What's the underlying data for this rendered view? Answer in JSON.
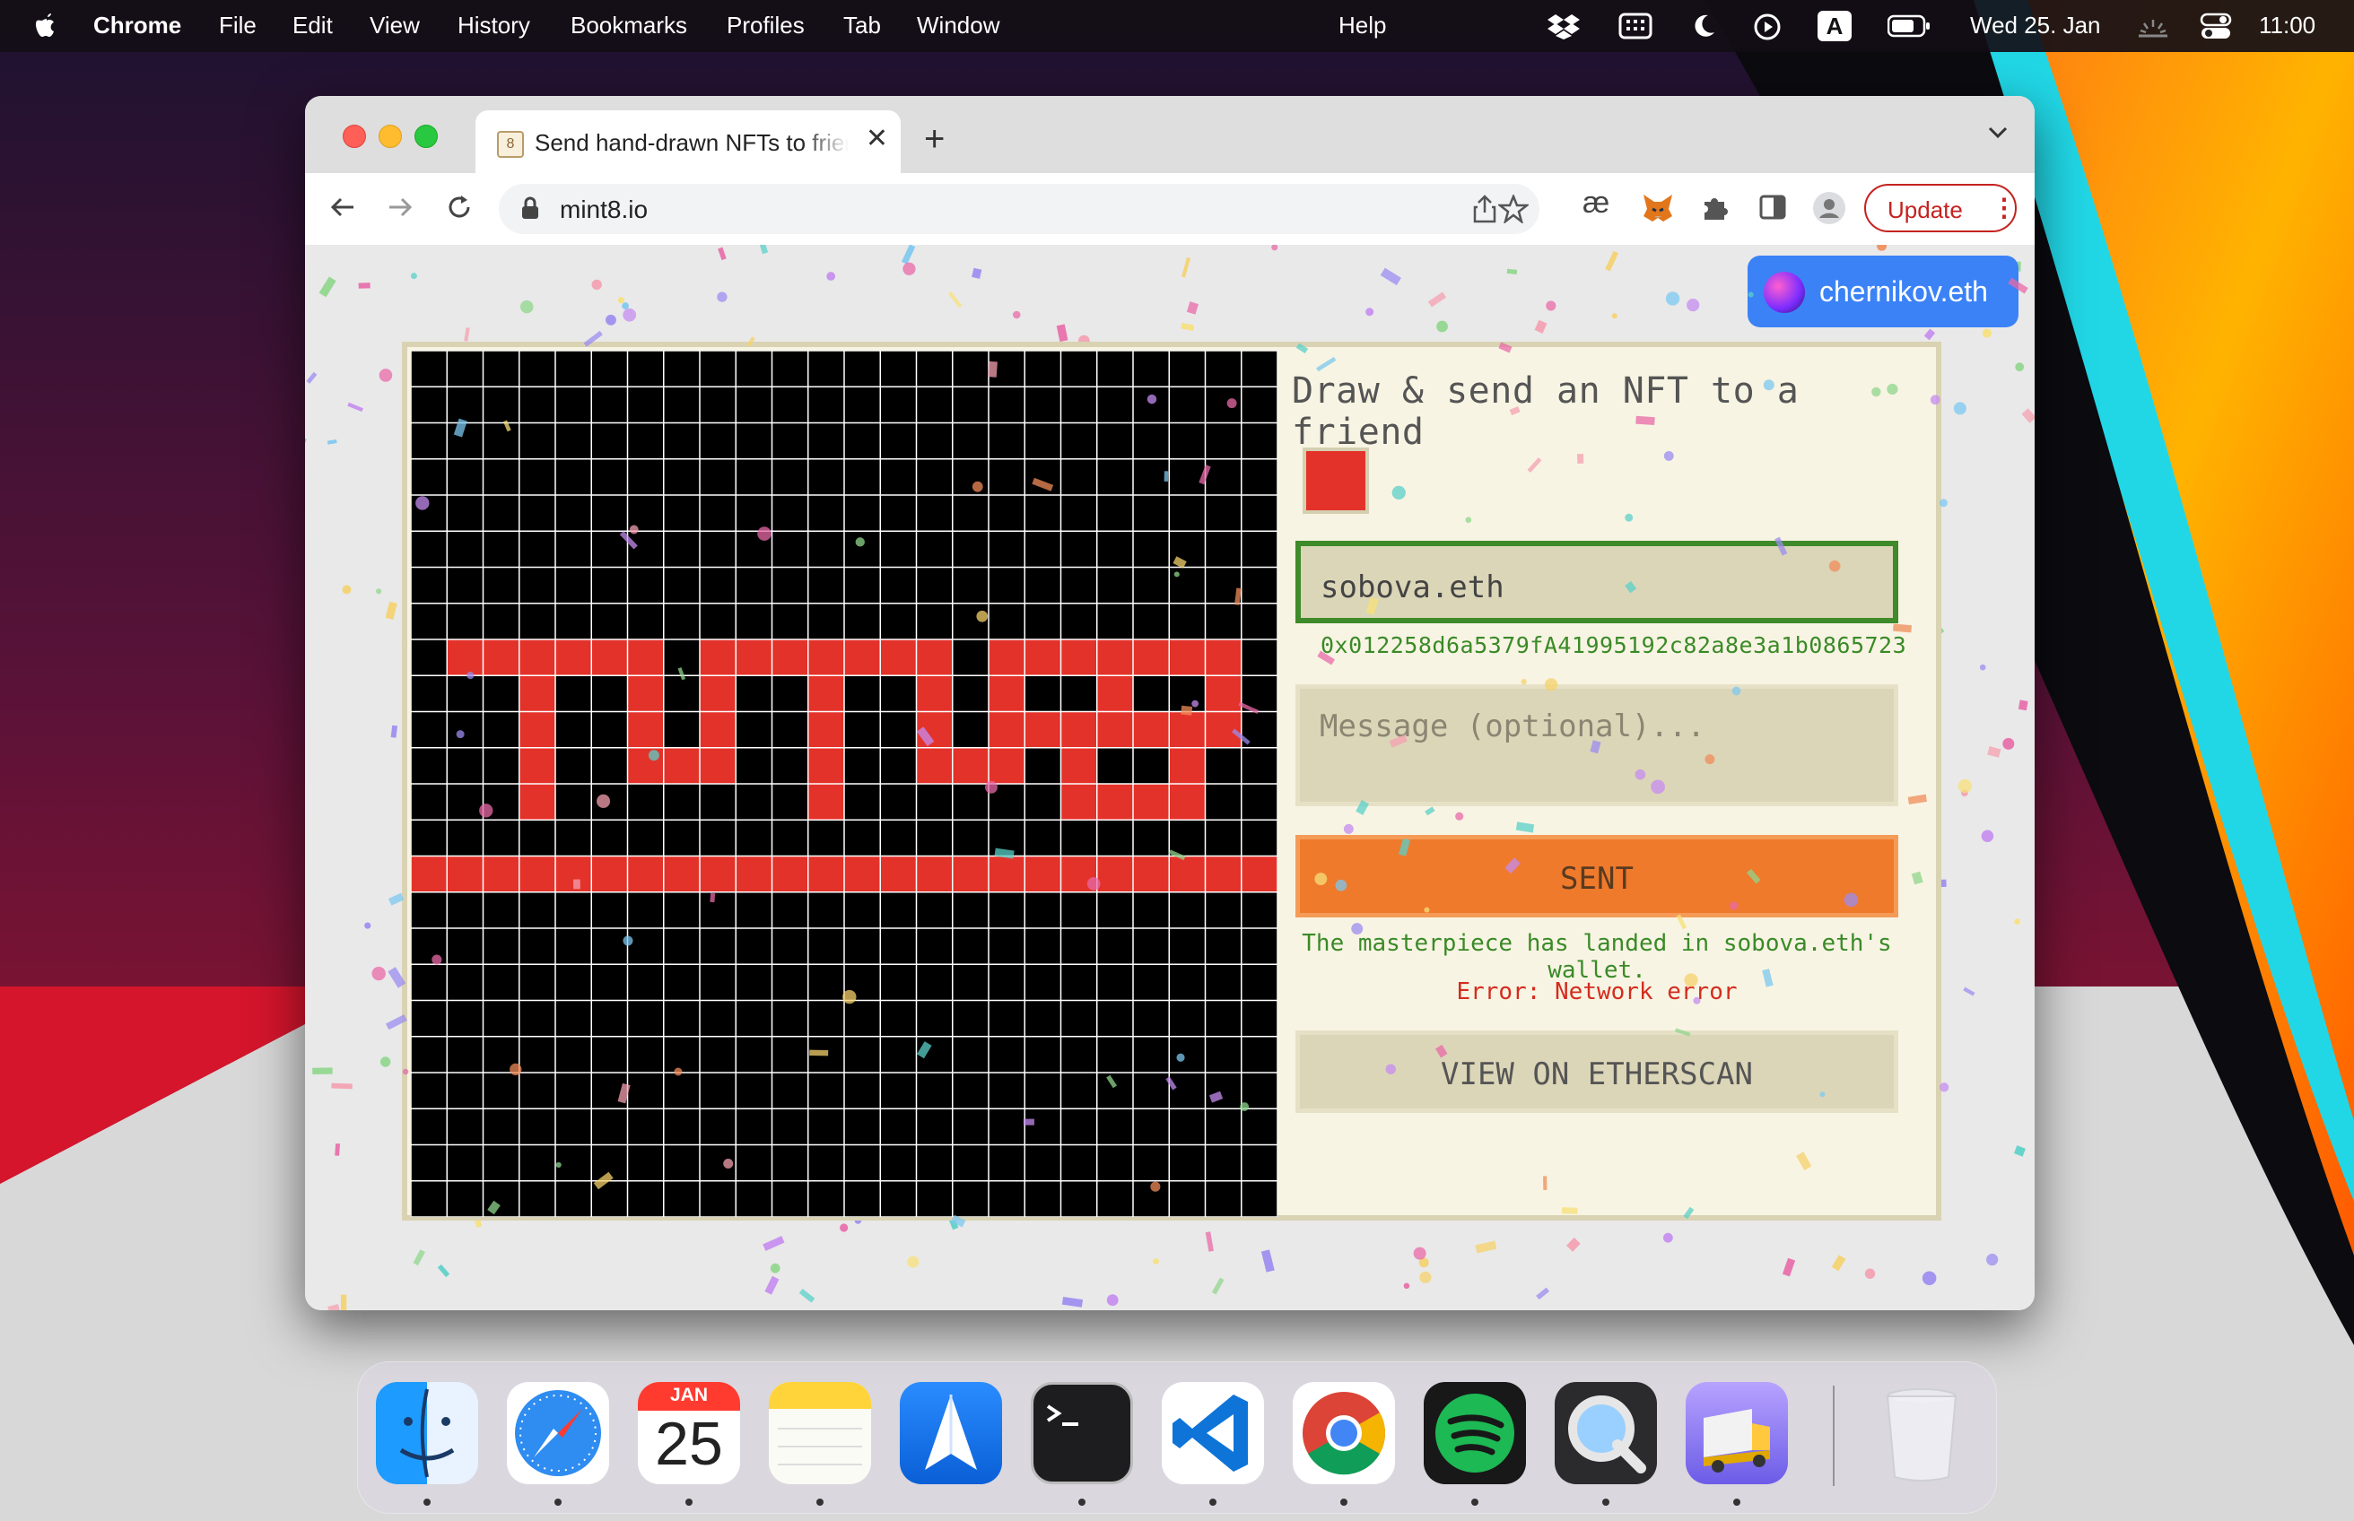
{
  "menubar": {
    "app": "Chrome",
    "items": [
      "File",
      "Edit",
      "View",
      "History",
      "Bookmarks",
      "Profiles",
      "Tab",
      "Window",
      "Help"
    ],
    "date": "Wed 25. Jan",
    "time": "11:00",
    "input_source": "A"
  },
  "browser": {
    "tab_title": "Send hand-drawn NFTs to friends",
    "url": "mint8.io",
    "update_label": "Update"
  },
  "page": {
    "wallet_name": "chernikov.eth",
    "heading": "Draw & send an NFT to a friend",
    "selected_color": "#e3322a",
    "recipient_value": "sobova.eth",
    "resolved_address": "0x012258d6a5379fA41995192c82a8e3a1b0865723",
    "message_placeholder": "Message (optional)...",
    "send_label": "SENT",
    "success_text": "The masterpiece has landed in sobova.eth's wallet.",
    "error_text": "Error: Network error",
    "etherscan_label": "VIEW ON ETHERSCAN"
  },
  "canvas": {
    "cols": 24,
    "rows": 24,
    "background": "#000000",
    "grid_color": "#ffffff",
    "pixel_color": "#e3322a",
    "painted_rows": [
      "........................",
      "........................",
      "........................",
      "........................",
      "........................",
      "........................",
      "........................",
      "........................",
      ".######.#######.#######.",
      "...#..#.#..#..#.#..#..#.",
      "...#..#.#..#..#.#######.",
      "...#..###..#..###.#..#..",
      "...#.......#......####..",
      "........................",
      "########################",
      "........................",
      "........................",
      "........................",
      "........................",
      "........................",
      "........................",
      "........................",
      "........................",
      "........................"
    ]
  },
  "dock": {
    "calendar_month": "JAN",
    "calendar_day": "25",
    "apps": [
      "finder",
      "safari",
      "calendar",
      "notes",
      "testflight",
      "terminal",
      "vscode",
      "chrome",
      "spotify",
      "quicktime",
      "transmit",
      "trash"
    ]
  }
}
